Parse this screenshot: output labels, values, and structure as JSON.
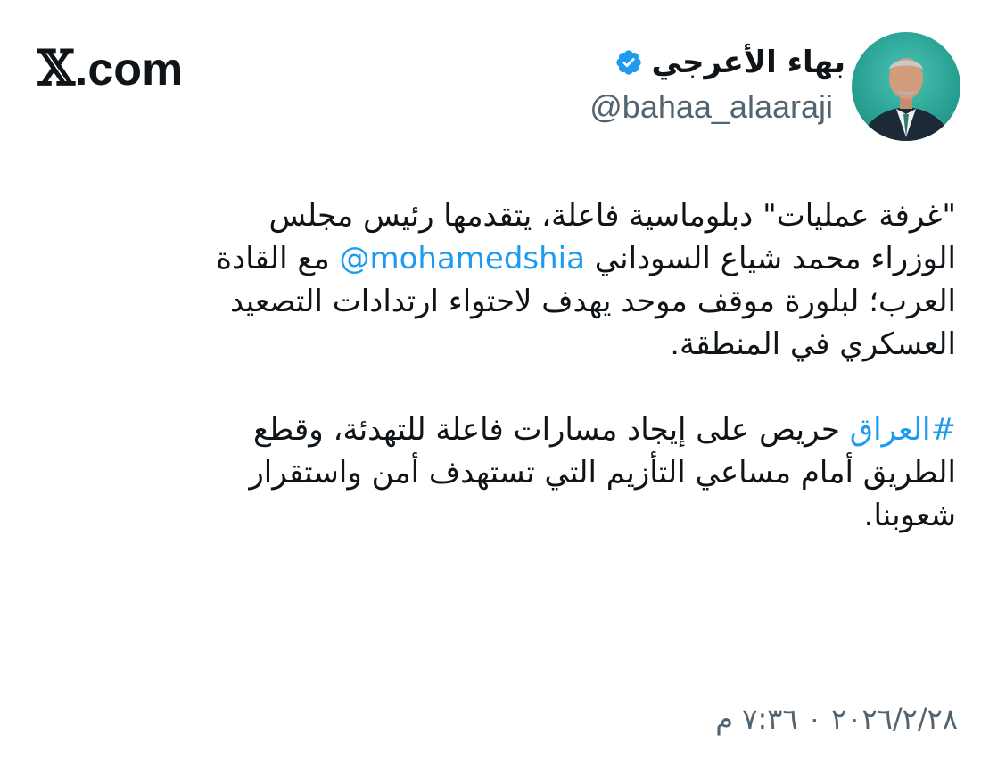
{
  "site": {
    "logo_mark": "𝕏",
    "logo_suffix": ".com"
  },
  "author": {
    "display_name": "بهاء الأعرجي",
    "handle": "@bahaa_alaaraji",
    "verified_icon": "verified-badge-icon",
    "verified_color": "#1d9bf0"
  },
  "tweet": {
    "p1": {
      "l1": "\"غرفة عمليات\" دبلوماسية فاعلة، يتقدمها رئيس مجلس",
      "l2_pre": "الوزراء محمد شياع السوداني ",
      "l2_mention": "@mohamedshia",
      "l2_post": " مع القادة",
      "l3": "العرب؛ لبلورة موقف موحد يهدف لاحتواء ارتدادات التصعيد",
      "l4": "العسكري في المنطقة."
    },
    "p2": {
      "l1_hashtag": "#العراق",
      "l1_post": " حريص على إيجاد مسارات فاعلة للتهدئة، وقطع",
      "l2": "الطريق أمام مساعي التأزيم التي تستهدف أمن واستقرار",
      "l3": "شعوبنا."
    },
    "timestamp": "٢٠٢٦/٢/٢٨ ٠ ٧:٣٦ م"
  },
  "colors": {
    "text": "#0f1419",
    "secondary": "#536471",
    "link": "#1d9bf0",
    "background": "#ffffff"
  }
}
